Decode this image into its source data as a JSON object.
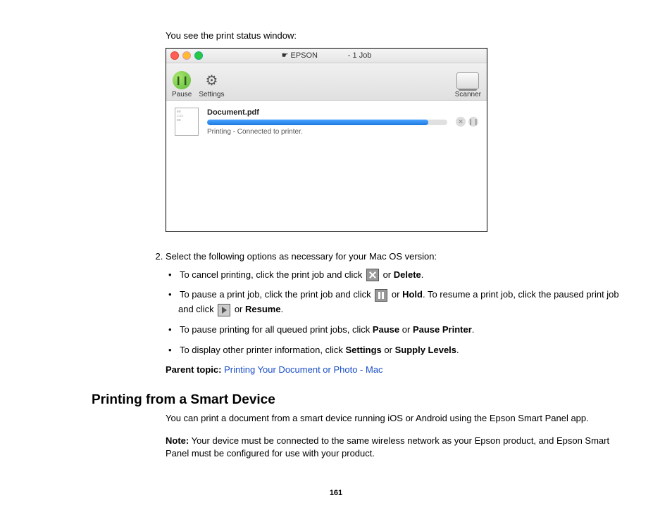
{
  "intro": "You see the print status window:",
  "window": {
    "title_prefix": "☛ EPSON",
    "title_suffix": "- 1 Job",
    "toolbar": {
      "pause": "Pause",
      "settings": "Settings",
      "scanner": "Scanner"
    },
    "job": {
      "name": "Document.pdf",
      "status": "Printing - Connected to printer."
    }
  },
  "step2": {
    "lead": "Select the following options as necessary for your Mac OS version:",
    "b1_a": "To cancel printing, click the print job and click ",
    "b1_b": " or ",
    "b1_bold": "Delete",
    "b1_c": ".",
    "b2_a": "To pause a print job, click the print job and click ",
    "b2_b": " or ",
    "b2_bold1": "Hold",
    "b2_c": ". To resume a print job, click the paused print job and click ",
    "b2_d": " or ",
    "b2_bold2": "Resume",
    "b2_e": ".",
    "b3_a": "To pause printing for all queued print jobs, click ",
    "b3_bold1": "Pause",
    "b3_b": " or ",
    "b3_bold2": "Pause Printer",
    "b3_c": ".",
    "b4_a": "To display other printer information, click ",
    "b4_bold1": "Settings",
    "b4_b": " or ",
    "b4_bold2": "Supply Levels",
    "b4_c": "."
  },
  "parent": {
    "label": "Parent topic:",
    "link": "Printing Your Document or Photo - Mac"
  },
  "section2": {
    "heading": "Printing from a Smart Device",
    "p1": "You can print a document from a smart device running iOS or Android using the Epson Smart Panel app.",
    "note_label": "Note:",
    "note_body": " Your device must be connected to the same wireless network as your Epson product, and Epson Smart Panel must be configured for use with your product."
  },
  "page_number": "161"
}
